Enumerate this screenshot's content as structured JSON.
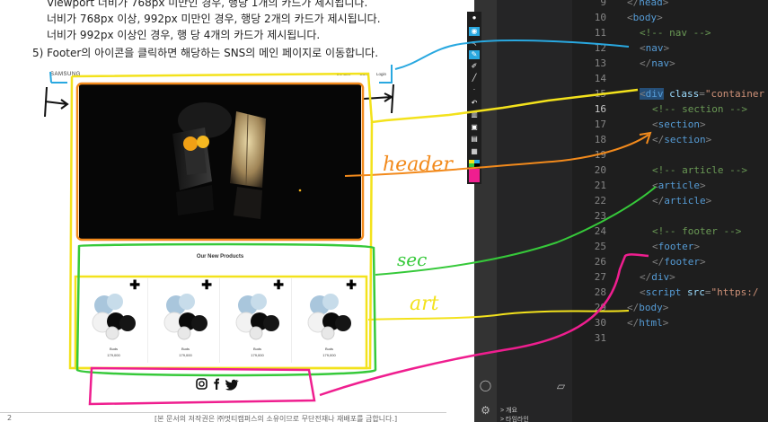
{
  "document": {
    "lines": [
      "Viewport 너비가 768px 미만인 경우, 행당 1개의 카드가 제시됩니다.",
      "너비가 768px 이상, 992px 미만인 경우, 행당 2개의 카드가 제시됩니다.",
      "너비가 992px 이상인 경우, 행 당 4개의 카드가 제시됩니다."
    ],
    "item5": "5)  Footer의 아이콘을 클릭하면 해당하는 SNS의 메인 페이지로 이동합니다.",
    "page_number": "2",
    "copyright": "[본 문서의 저작권은 ㈜멋티캠퍼스의 소유이므로 무단전재나 재배포를 금합니다.]"
  },
  "mock": {
    "logo": "SAMSUNG",
    "links": [
      "Contact",
      "Cart",
      "Login"
    ],
    "section_title": "Our New Products",
    "products": [
      {
        "name": "Buds",
        "price": "179,000"
      },
      {
        "name": "Buds",
        "price": "179,000"
      },
      {
        "name": "Buds",
        "price": "179,000"
      },
      {
        "name": "Buds",
        "price": "179,000"
      }
    ]
  },
  "annotations": {
    "header": "header",
    "sec": "sec",
    "art": "art"
  },
  "editor": {
    "panel_rows": [
      "> 개요",
      "> 타임라인"
    ],
    "line_numbers": [
      "9",
      "10",
      "11",
      "12",
      "13",
      "14",
      "15",
      "16",
      "17",
      "18",
      "19",
      "20",
      "21",
      "22",
      "23",
      "24",
      "25",
      "26",
      "27",
      "28",
      "29",
      "30",
      "31"
    ],
    "current_line": "16"
  },
  "colors": {
    "editor_bg": "#1e1e1e",
    "annot_blue": "#29a8e0",
    "annot_orange": "#f28a1c",
    "annot_yellow": "#f3e21c",
    "annot_green": "#36c93a",
    "annot_pink": "#ef1e8f",
    "annot_black": "#111111"
  },
  "icons": [
    "pen-icon",
    "eye-icon",
    "pointer-icon",
    "highlighter-icon",
    "marker-icon",
    "line-icon",
    "dot-icon",
    "undo-icon",
    "trash-icon",
    "camera-icon",
    "save-icon",
    "color-swatch-icon",
    "account-icon",
    "settings-icon",
    "eraser-icon"
  ]
}
